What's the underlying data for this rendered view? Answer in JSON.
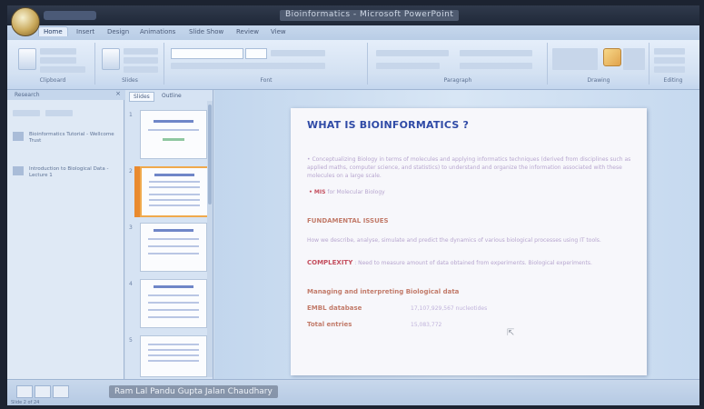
{
  "app": {
    "window_title": "Bioinformatics - Microsoft PowerPoint"
  },
  "ribbon": {
    "tabs": [
      "Home",
      "Insert",
      "Design",
      "Animations",
      "Slide Show",
      "Review",
      "View"
    ],
    "active_tab": "Home",
    "groups": [
      "Clipboard",
      "Slides",
      "Font",
      "Paragraph",
      "Drawing",
      "Editing"
    ]
  },
  "left_panel": {
    "title": "Research",
    "items": [
      {
        "label": "Bioinformatics Tutorial - Wellcome Trust"
      },
      {
        "label": "Introduction to Biological Data - Lecture 1"
      }
    ]
  },
  "slides_pane": {
    "tabs": [
      "Slides",
      "Outline"
    ],
    "active": "Slides",
    "thumbnails": [
      1,
      2,
      3,
      4,
      5
    ],
    "selected": 2
  },
  "slide": {
    "title": "WHAT IS BIOINFORMATICS ?",
    "body": "• Conceptualizing Biology in terms of molecules and applying informatics techniques (derived from disciplines such as applied maths, computer science, and statistics) to understand and organize the information associated with these molecules on a large scale.",
    "mis_label": "• MIS",
    "mis_text": "for Molecular Biology",
    "heading": "FUNDAMENTAL ISSUES",
    "issues_text": "How we describe, analyse, simulate and predict the dynamics of various biological processes using IT tools.",
    "complexity_label": "COMPLEXITY",
    "complexity_text": ": Need to measure amount of data obtained from experiments. Biological experiments.",
    "managing": "Managing and interpreting Biological data",
    "rows": [
      {
        "key": "EMBL database",
        "value": "17,107,929,567 nucleotides"
      },
      {
        "key": "Total entries",
        "value": "15,083,772"
      }
    ]
  },
  "status": {
    "caption": "Ram Lal Pandu Gupta Jalan Chaudhary",
    "slide_info": "Slide 2 of 24"
  }
}
